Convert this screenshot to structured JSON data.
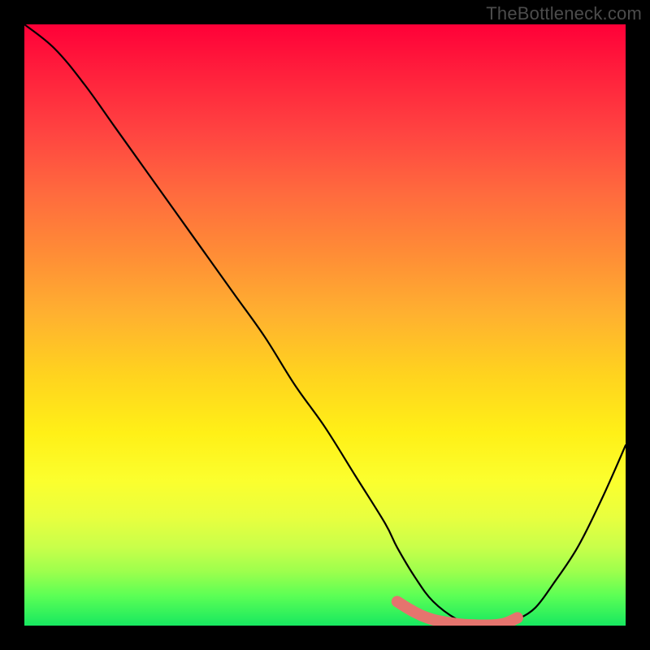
{
  "watermark": "TheBottleneck.com",
  "chart_data": {
    "type": "line",
    "title": "",
    "xlabel": "",
    "ylabel": "",
    "xlim": [
      0,
      100
    ],
    "ylim": [
      0,
      100
    ],
    "grid": false,
    "legend": false,
    "series": [
      {
        "name": "bottleneck-curve",
        "x": [
          0,
          5,
          10,
          15,
          20,
          25,
          30,
          35,
          40,
          45,
          50,
          55,
          60,
          62,
          65,
          68,
          72,
          75,
          78,
          80,
          82,
          85,
          88,
          92,
          96,
          100
        ],
        "values": [
          100,
          96,
          90,
          83,
          76,
          69,
          62,
          55,
          48,
          40,
          33,
          25,
          17,
          13,
          8,
          4,
          1,
          0,
          0,
          0,
          1,
          3,
          7,
          13,
          21,
          30
        ]
      }
    ],
    "optimal_range": {
      "name": "optimal-band",
      "color": "#e5746e",
      "x": [
        62,
        65,
        68,
        72,
        75,
        78,
        80,
        82
      ],
      "values": [
        4,
        2.2,
        1.0,
        0.3,
        0.1,
        0.1,
        0.4,
        1.3
      ]
    },
    "background_gradient": {
      "top_color": "#ff0038",
      "mid_color": "#fff017",
      "bottom_color": "#17e860"
    }
  }
}
